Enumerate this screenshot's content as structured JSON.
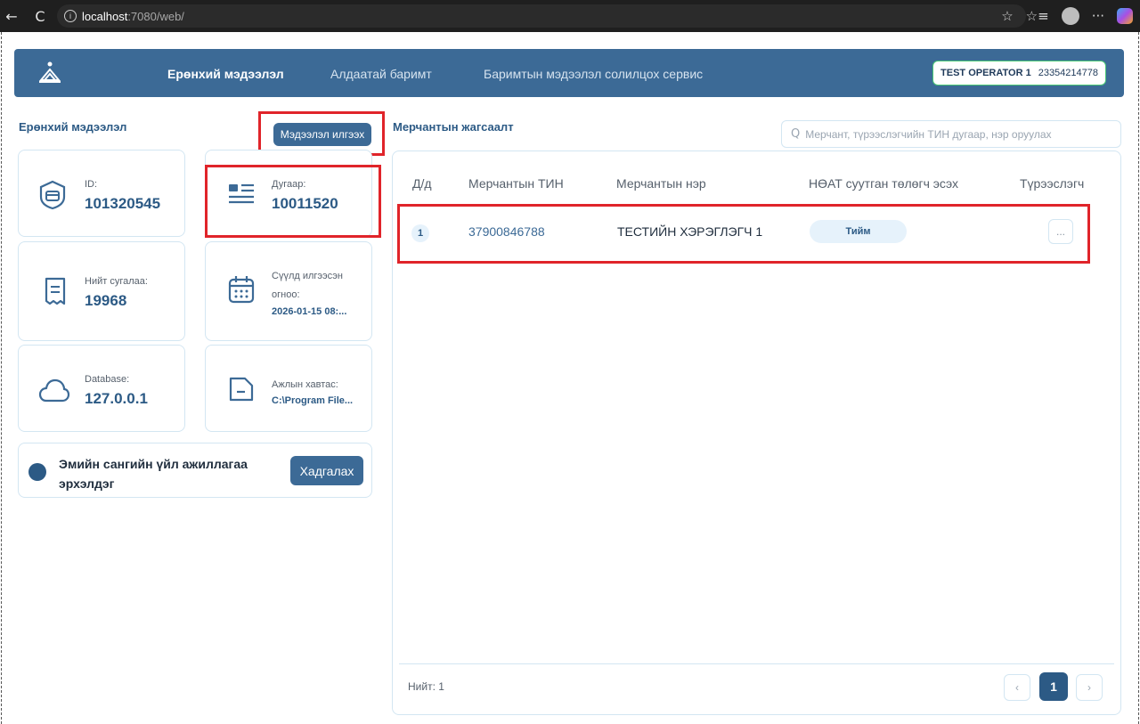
{
  "browser": {
    "url_host": "localhost",
    "url_path": ":7080/web/",
    "back_glyph": "←",
    "reload_glyph": "C",
    "info_glyph": "i",
    "icons": [
      "star-icon",
      "favorites-icon",
      "profile-icon",
      "more-icon",
      "copilot-icon"
    ],
    "star_glyph": "☆",
    "favorites_glyph": "☆≡",
    "more_glyph": "···"
  },
  "header": {
    "nav": [
      "Ерөнхий мэдээлэл",
      "Алдаатай баримт",
      "Баримтын мэдээлэл солилцох сервис"
    ],
    "operator_name": "TEST OPERATOR 1",
    "operator_number": "23354214778"
  },
  "left": {
    "title": "Ерөнхий мэдээлэл",
    "send_button": "Мэдээлэл илгээх",
    "cards": {
      "id_label": "ID:",
      "id_value": "101320545",
      "number_label": "Дугаар:",
      "number_value": "10011520",
      "receipts_label": "Нийт сугалаа:",
      "receipts_value": "19968",
      "last_sent_label_1": "Сүүлд илгээсэн",
      "last_sent_label_2": "огноо:",
      "last_sent_value": "2026-01-15 08:...",
      "database_label": "Database:",
      "database_value": "127.0.0.1",
      "folder_label": "Ажлын хавтас:",
      "folder_value": "C:\\Program File..."
    },
    "pharmacy_text": "Эмийн сангийн үйл ажиллагаа эрхэлдэг",
    "save_button": "Хадгалах"
  },
  "right": {
    "title": "Мерчантын жагсаалт",
    "search_placeholder": "Мерчант, түрээслэгчийн ТИН дугаар, нэр оруулах",
    "search_glyph": "Q",
    "columns": [
      "Д/д",
      "Мерчантын ТИН",
      "Мерчантын нэр",
      "НӨАТ суутган төлөгч эсэх",
      "Түрээслэгч"
    ],
    "rows": [
      {
        "index": "1",
        "tin": "37900846788",
        "name": "ТЕСТИЙН ХЭРЭГЛЭГЧ 1",
        "vat": "Тийм",
        "more": "..."
      }
    ],
    "total": "Нийт: 1",
    "pagination": {
      "prev": "‹",
      "current": "1",
      "next": "›"
    }
  },
  "colors": {
    "primary": "#3c6a96",
    "highlight_red": "#e0242a",
    "operator_border": "#48c774"
  }
}
